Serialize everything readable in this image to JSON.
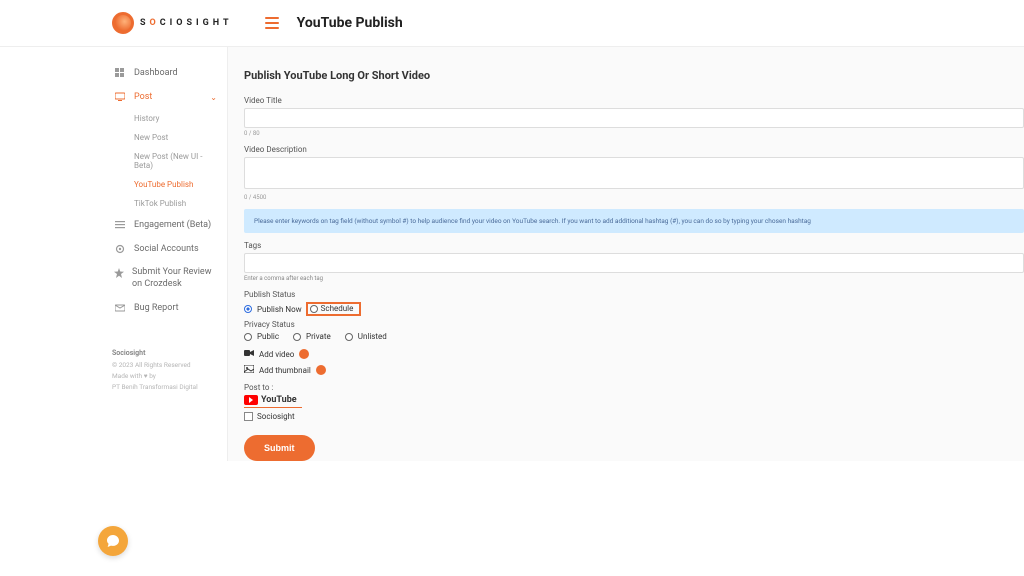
{
  "header": {
    "brand": "SOCIOSIGHT",
    "page_title": "YouTube Publish"
  },
  "sidebar": {
    "items": [
      {
        "label": "Dashboard"
      },
      {
        "label": "Post"
      },
      {
        "label": "Engagement (Beta)"
      },
      {
        "label": "Social Accounts"
      },
      {
        "label": "Submit Your Review on Crozdesk"
      },
      {
        "label": "Bug Report"
      }
    ],
    "post_sub": [
      {
        "label": "History"
      },
      {
        "label": "New Post"
      },
      {
        "label": "New Post (New UI - Beta)"
      },
      {
        "label": "YouTube Publish"
      },
      {
        "label": "TikTok Publish"
      }
    ],
    "footer": {
      "brand": "Sociosight",
      "copy": "© 2023 All Rights Reserved",
      "made": "Made with ♥ by",
      "company": "PT Benih Transformasi Digital"
    }
  },
  "form": {
    "panel_title": "Publish YouTube Long Or Short Video",
    "title_label": "Video Title",
    "title_counter": "0 / 80",
    "desc_label": "Video Description",
    "desc_counter": "0 / 4500",
    "hint": "Please enter keywords on tag field (without symbol #) to help audience find your video on YouTube search. If you want to add additional hashtag (#), you can do so by typing your chosen hashtag",
    "tags_label": "Tags",
    "tags_help": "Enter a comma after each tag",
    "publish_status_label": "Publish Status",
    "publish_now": "Publish Now",
    "schedule": "Schedule",
    "privacy_label": "Privacy Status",
    "public": "Public",
    "private": "Private",
    "unlisted": "Unlisted",
    "add_video": "Add video",
    "add_thumb": "Add thumbnail",
    "post_to": "Post to :",
    "youtube": "YouTube",
    "account": "Sociosight",
    "submit": "Submit"
  }
}
